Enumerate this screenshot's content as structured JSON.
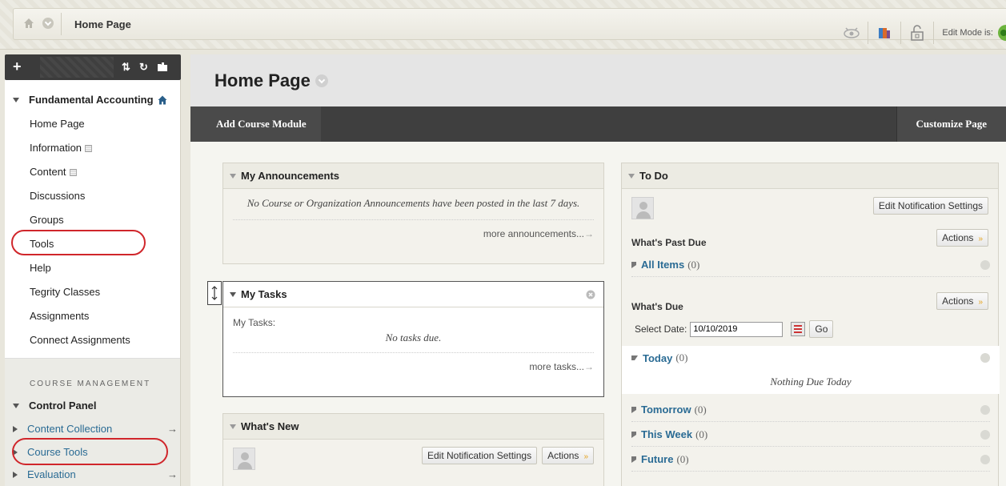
{
  "breadcrumb": {
    "current": "Home Page"
  },
  "top_right": {
    "edit_mode_label": "Edit Mode is:"
  },
  "sidebar": {
    "course_title": "Fundamental Accounting",
    "items": [
      {
        "label": "Home Page",
        "has_icon": false
      },
      {
        "label": "Information",
        "has_icon": true
      },
      {
        "label": "Content",
        "has_icon": true
      },
      {
        "label": "Discussions",
        "has_icon": false
      },
      {
        "label": "Groups",
        "has_icon": false
      },
      {
        "label": "Tools",
        "has_icon": false
      },
      {
        "label": "Help",
        "has_icon": false
      },
      {
        "label": "Tegrity Classes",
        "has_icon": false
      },
      {
        "label": "Assignments",
        "has_icon": false
      },
      {
        "label": "Connect Assignments",
        "has_icon": false
      }
    ],
    "management_title": "COURSE MANAGEMENT",
    "control_panel": "Control Panel",
    "mgmt_items": [
      {
        "label": "Content Collection",
        "arrow": "→"
      },
      {
        "label": "Course Tools",
        "arrow": ""
      },
      {
        "label": "Evaluation",
        "arrow": "→"
      }
    ]
  },
  "page": {
    "title": "Home Page",
    "add_module": "Add Course Module",
    "customize": "Customize Page"
  },
  "announcements": {
    "title": "My Announcements",
    "message": "No Course or Organization Announcements have been posted in the last 7 days.",
    "more": "more announcements...",
    "more_arrow": "→"
  },
  "tasks": {
    "title": "My Tasks",
    "label": "My Tasks:",
    "message": "No tasks due.",
    "more": "more tasks...",
    "more_arrow": "→"
  },
  "whats_new": {
    "title": "What's New",
    "edit_notifications": "Edit Notification Settings",
    "actions": "Actions"
  },
  "todo": {
    "title": "To Do",
    "edit_notifications": "Edit Notification Settings",
    "past_due": "What's Past Due",
    "actions": "Actions",
    "all_items": "All Items",
    "all_items_count": "(0)",
    "whats_due": "What's Due",
    "select_date_label": "Select Date:",
    "date_value": "10/10/2019",
    "go": "Go",
    "today": "Today",
    "today_count": "(0)",
    "nothing_due": "Nothing Due Today",
    "tomorrow": "Tomorrow",
    "tomorrow_count": "(0)",
    "this_week": "This Week",
    "this_week_count": "(0)",
    "future": "Future",
    "future_count": "(0)"
  },
  "icons": {
    "double_chevron": "»",
    "arrow": "→"
  }
}
